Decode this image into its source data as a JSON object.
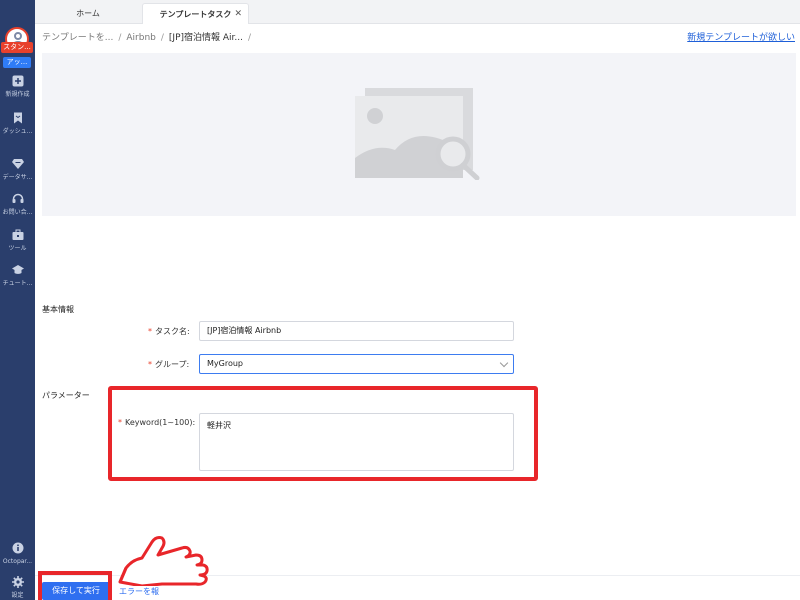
{
  "sidebar": {
    "plan_badge": "スタン...",
    "app_badge": "アッ...",
    "items": [
      {
        "label": "新規作成",
        "icon": "plus-square-icon"
      },
      {
        "label": "ダッシュ...",
        "icon": "bookmark-icon"
      },
      {
        "label": "データサ...",
        "icon": "diamond-icon"
      },
      {
        "label": "お問い合...",
        "icon": "headset-icon"
      },
      {
        "label": "ツール",
        "icon": "toolbox-icon"
      },
      {
        "label": "チュート...",
        "icon": "graduation-cap-icon"
      }
    ],
    "bottom_items": [
      {
        "label": "Octopar...",
        "icon": "info-icon"
      },
      {
        "label": "設定",
        "icon": "gear-icon"
      }
    ]
  },
  "tabs": [
    {
      "label": "ホーム"
    },
    {
      "label": "テンプレートタスク",
      "active": true
    }
  ],
  "breadcrumb": {
    "items": [
      "テンプレートを...",
      "Airbnb",
      "[JP]宿泊情報 Air..."
    ],
    "separator": "/"
  },
  "header": {
    "new_template_link": "新規テンプレートが欲しい"
  },
  "preview": {
    "icon": "image-placeholder-search-icon"
  },
  "form": {
    "basic_section": "基本情報",
    "task_name_label": "タスク名:",
    "task_name_value": "[JP]宿泊情報 Airbnb",
    "group_label": "グループ:",
    "group_value": "MyGroup",
    "param_section": "パラメーター",
    "keyword_label": "Keyword(1~100):",
    "keyword_value": "軽井沢"
  },
  "footer": {
    "save_run": "保存して実行",
    "cancel": "エラーを報"
  },
  "colors": {
    "sidebar_bg": "#2a3e6c",
    "primary": "#2f6ff0",
    "highlight": "#e8262a",
    "required": "#e8412c"
  }
}
